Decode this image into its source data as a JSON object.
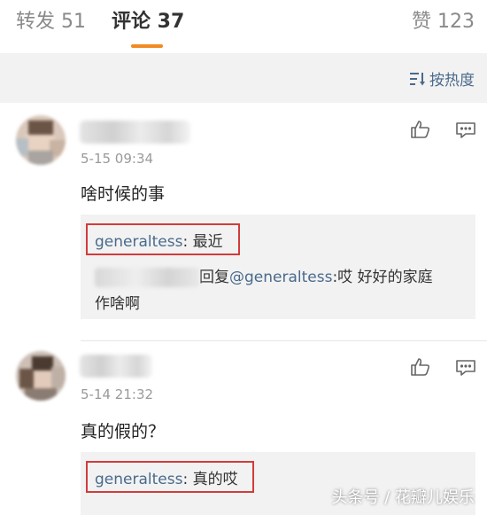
{
  "tabs": {
    "repost": "转发 51",
    "comments": "评论 37",
    "likes": "赞 123"
  },
  "sort": {
    "label": "按热度",
    "icon": "sort-icon"
  },
  "comments": [
    {
      "time": "5-15 09:34",
      "text": "啥时候的事",
      "replies": [
        {
          "user": "generaltess",
          "sep": ": ",
          "text": "最近"
        }
      ],
      "sub_reply": {
        "verb": "回复",
        "mention": "@generaltess",
        "text_line1": ":哎 好好的家庭",
        "text_line2": "作啥啊"
      }
    },
    {
      "time": "5-14 21:32",
      "text": "真的假的？",
      "replies": [
        {
          "user": "generaltess",
          "sep": ": ",
          "text": "真的哎"
        }
      ]
    }
  ],
  "watermark": "头条号 / 花瓣儿娱乐",
  "colors": {
    "accent": "#f08a24",
    "link": "#4a6a8c",
    "highlight": "#d23c3c"
  }
}
